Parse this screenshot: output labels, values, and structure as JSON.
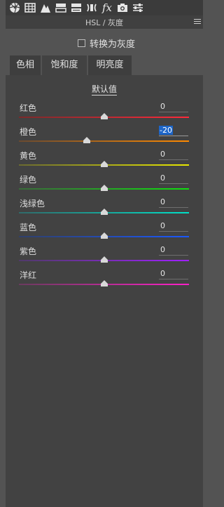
{
  "toolbar": {
    "tools": [
      {
        "icon": "aperture-icon"
      },
      {
        "icon": "grid-icon"
      },
      {
        "icon": "tone-curve-icon"
      },
      {
        "icon": "hsl-icon"
      },
      {
        "icon": "split-toning-icon"
      },
      {
        "icon": "lens-icon"
      },
      {
        "icon": "fx-icon",
        "label": "fx"
      },
      {
        "icon": "camera-icon"
      },
      {
        "icon": "presets-icon"
      }
    ]
  },
  "panel": {
    "title": "HSL / 灰度",
    "convert_label": "转换为灰度",
    "convert_checked": false
  },
  "tabs": [
    {
      "label": "色相",
      "active": false
    },
    {
      "label": "饱和度",
      "active": true
    },
    {
      "label": "明亮度",
      "active": false
    }
  ],
  "default_link": "默认值",
  "sliders": [
    {
      "label": "红色",
      "value": "0",
      "fraction": 0.5,
      "colors": [
        "#7a2a2a",
        "#ff2a3a"
      ]
    },
    {
      "label": "橙色",
      "value": "-20",
      "fraction": 0.4,
      "active": true,
      "colors": [
        "#6a4a30",
        "#ff8a00"
      ]
    },
    {
      "label": "黄色",
      "value": "0",
      "fraction": 0.5,
      "colors": [
        "#6a6a30",
        "#e8e800"
      ]
    },
    {
      "label": "绿色",
      "value": "0",
      "fraction": 0.5,
      "colors": [
        "#3a6a3a",
        "#10e010"
      ]
    },
    {
      "label": "浅绿色",
      "value": "0",
      "fraction": 0.5,
      "colors": [
        "#306a6a",
        "#00e0c8"
      ]
    },
    {
      "label": "蓝色",
      "value": "0",
      "fraction": 0.5,
      "colors": [
        "#30406a",
        "#1a58ff"
      ]
    },
    {
      "label": "紫色",
      "value": "0",
      "fraction": 0.5,
      "colors": [
        "#503a6a",
        "#a020ff"
      ]
    },
    {
      "label": "洋红",
      "value": "0",
      "fraction": 0.5,
      "colors": [
        "#6a3a5e",
        "#ff20c8"
      ]
    }
  ]
}
